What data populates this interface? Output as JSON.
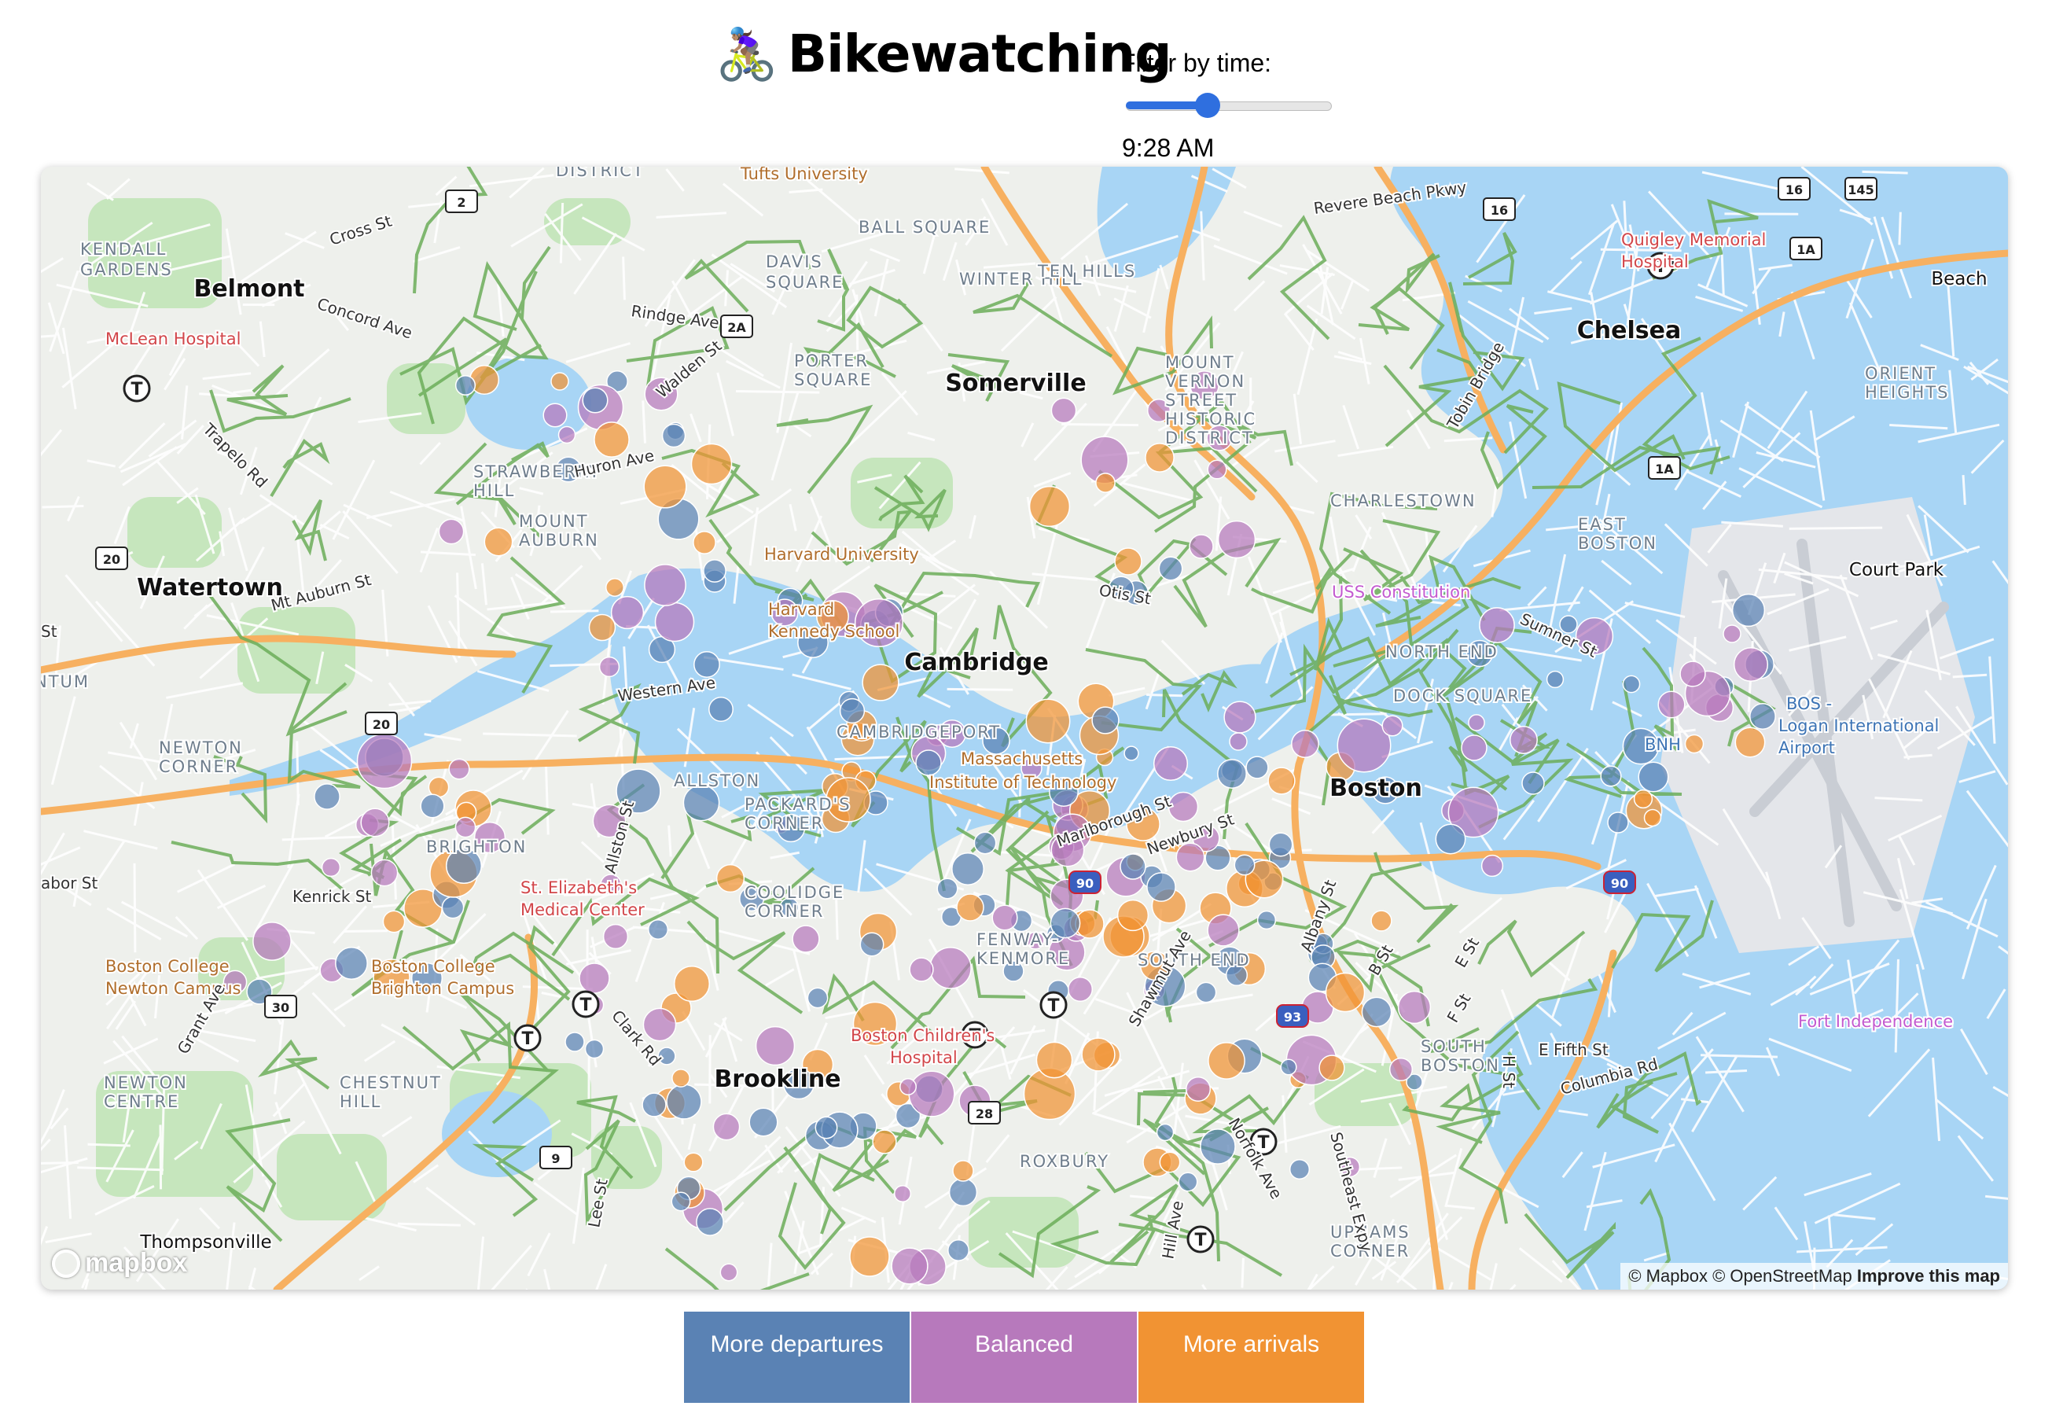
{
  "header": {
    "emoji": "🚴🏽‍♀️",
    "title": "Bikewatching",
    "filter_label": "Filter by time:",
    "slider_value_fraction": 0.4,
    "time_value": "9:28 AM"
  },
  "map": {
    "place_labels": [
      {
        "text": "Belmont",
        "size": "big"
      },
      {
        "text": "Somerville",
        "size": "big"
      },
      {
        "text": "Chelsea",
        "size": "big"
      },
      {
        "text": "Watertown",
        "size": "big"
      },
      {
        "text": "Cambridge",
        "size": "big"
      },
      {
        "text": "Boston",
        "size": "big"
      },
      {
        "text": "Brookline",
        "size": "big"
      },
      {
        "text": "Court Park",
        "size": "mid"
      },
      {
        "text": "Beach",
        "size": "mid"
      },
      {
        "text": "Thompsonville",
        "size": "mid"
      },
      {
        "text": "DISTRICT",
        "size": "hood"
      },
      {
        "text": "KENDALL",
        "size": "hood"
      },
      {
        "text": "GARDENS",
        "size": "hood"
      },
      {
        "text": "DAVIS",
        "size": "hood"
      },
      {
        "text": "SQUARE",
        "size": "hood"
      },
      {
        "text": "BALL SQUARE",
        "size": "hood"
      },
      {
        "text": "WINTER HILL",
        "size": "hood"
      },
      {
        "text": "TEN HILLS",
        "size": "hood"
      },
      {
        "text": "PORTER",
        "size": "hood"
      },
      {
        "text": "SQUARE",
        "size": "hood"
      },
      {
        "text": "MOUNT",
        "size": "hood"
      },
      {
        "text": "VERNON",
        "size": "hood"
      },
      {
        "text": "STREET",
        "size": "hood"
      },
      {
        "text": "HISTORIC",
        "size": "hood"
      },
      {
        "text": "DISTRICT",
        "size": "hood"
      },
      {
        "text": "STRAWBERRY",
        "size": "hood"
      },
      {
        "text": "HILL",
        "size": "hood"
      },
      {
        "text": "MOUNT",
        "size": "hood"
      },
      {
        "text": "AUBURN",
        "size": "hood"
      },
      {
        "text": "CHARLESTOWN",
        "size": "hood"
      },
      {
        "text": "EAST",
        "size": "hood"
      },
      {
        "text": "BOSTON",
        "size": "hood"
      },
      {
        "text": "ORIENT",
        "size": "hood"
      },
      {
        "text": "HEIGHTS",
        "size": "hood"
      },
      {
        "text": "NORTH END",
        "size": "hood"
      },
      {
        "text": "DOCK SQUARE",
        "size": "hood"
      },
      {
        "text": "NEWTON",
        "size": "hood"
      },
      {
        "text": "CORNER",
        "size": "hood"
      },
      {
        "text": "CAMBRIDGEPORT",
        "size": "hood"
      },
      {
        "text": "ALLSTON",
        "size": "hood"
      },
      {
        "text": "PACKARD'S",
        "size": "hood"
      },
      {
        "text": "CORNER",
        "size": "hood"
      },
      {
        "text": "BRIGHTON",
        "size": "hood"
      },
      {
        "text": "COOLIDGE",
        "size": "hood"
      },
      {
        "text": "CORNER",
        "size": "hood"
      },
      {
        "text": "FENWAY-",
        "size": "hood"
      },
      {
        "text": "KENMORE",
        "size": "hood"
      },
      {
        "text": "SOUTH END",
        "size": "hood"
      },
      {
        "text": "SOUTH",
        "size": "hood"
      },
      {
        "text": "BOSTON",
        "size": "hood"
      },
      {
        "text": "NEWTON",
        "size": "hood"
      },
      {
        "text": "CENTRE",
        "size": "hood"
      },
      {
        "text": "CHESTNUT",
        "size": "hood"
      },
      {
        "text": "HILL",
        "size": "hood"
      },
      {
        "text": "ROXBURY",
        "size": "hood"
      },
      {
        "text": "UPHAMS",
        "size": "hood"
      },
      {
        "text": "CORNER",
        "size": "hood"
      },
      {
        "text": "NTUM",
        "size": "hood"
      }
    ],
    "poi_labels": [
      {
        "text": "Tufts University",
        "kind": "edu"
      },
      {
        "text": "Quigley Memorial",
        "kind": "med"
      },
      {
        "text": "Hospital",
        "kind": "med"
      },
      {
        "text": "McLean Hospital",
        "kind": "med"
      },
      {
        "text": "Harvard University",
        "kind": "edu"
      },
      {
        "text": "Harvard",
        "kind": "edu"
      },
      {
        "text": "Kennedy School",
        "kind": "edu"
      },
      {
        "text": "USS Constitution",
        "kind": "hist"
      },
      {
        "text": "Massachusetts",
        "kind": "edu"
      },
      {
        "text": "Institute of Technology",
        "kind": "edu"
      },
      {
        "text": "St. Elizabeth's",
        "kind": "med"
      },
      {
        "text": "Medical Center",
        "kind": "med"
      },
      {
        "text": "Boston College",
        "kind": "edu"
      },
      {
        "text": "Newton Campus",
        "kind": "edu"
      },
      {
        "text": "Boston College",
        "kind": "edu"
      },
      {
        "text": "Brighton Campus",
        "kind": "edu"
      },
      {
        "text": "Boston Children's",
        "kind": "med"
      },
      {
        "text": "Hospital",
        "kind": "med"
      },
      {
        "text": "Fort Independence",
        "kind": "hist"
      },
      {
        "text": "BOS -",
        "kind": "air"
      },
      {
        "text": "Logan International",
        "kind": "air"
      },
      {
        "text": "Airport",
        "kind": "air"
      },
      {
        "text": "BNH",
        "kind": "air"
      }
    ],
    "street_labels": [
      "Cross St",
      "Concord Ave",
      "Rindge Ave",
      "Walden St",
      "Huron Ave",
      "Trapelo Rd",
      "Mt Auburn St",
      "Western Ave",
      "Otis St",
      "Revere Beach Pkwy",
      "Tobin Bridge",
      "Sumner St",
      "Kenrick St",
      "Allston St",
      "Clark Rd",
      "Grant Ave",
      "Marlborough St",
      "Newbury St",
      "Shawmut Ave",
      "Albany St",
      "B St",
      "E St",
      "F St",
      "H St",
      "E Fifth St",
      "Columbia Rd",
      "Norfolk Ave",
      "Southeast Expy",
      "Lee St",
      "Hill Ave",
      "St",
      "abor St"
    ],
    "shields": [
      "2",
      "2A",
      "16",
      "16",
      "145",
      "1A",
      "1A",
      "20",
      "20",
      "30",
      "9",
      "28",
      "90",
      "90",
      "93"
    ],
    "attribution": {
      "mapbox": "© Mapbox",
      "osm": "© OpenStreetMap",
      "improve": "Improve this map"
    },
    "logo_text": "mapbox"
  },
  "colors": {
    "departures": "#5a82b4",
    "balanced": "#b779bc",
    "arrivals": "#f19333",
    "water": "#a8d5f5",
    "park": "#c6e6bd",
    "bike_lane": "#6cae5a",
    "highway": "#f7b060"
  },
  "legend": [
    {
      "label": "More departures",
      "color": "#5a82b4"
    },
    {
      "label": "Balanced",
      "color": "#b779bc"
    },
    {
      "label": "More arrivals",
      "color": "#f19333"
    }
  ],
  "stations": [
    {
      "t": "d",
      "v": 3
    },
    {
      "t": "d",
      "v": 2
    },
    {
      "t": "b",
      "v": 2
    },
    {
      "t": "d",
      "v": 4
    },
    {
      "t": "b",
      "v": 4
    },
    {
      "t": "o",
      "v": 3
    },
    {
      "t": "d",
      "v": 5
    },
    {
      "t": "b",
      "v": 6
    },
    {
      "t": "d",
      "v": 3
    },
    {
      "t": "b",
      "v": 3
    },
    {
      "t": "d",
      "v": 5
    },
    {
      "t": "o",
      "v": 6
    },
    {
      "t": "d",
      "v": 4
    },
    {
      "t": "b",
      "v": 6
    },
    {
      "t": "o",
      "v": 7
    },
    {
      "t": "d",
      "v": 6
    },
    {
      "t": "b",
      "v": 8
    },
    {
      "t": "o",
      "v": 8
    },
    {
      "t": "d",
      "v": 7
    },
    {
      "t": "b",
      "v": 9
    },
    {
      "t": "o",
      "v": 9
    },
    {
      "t": "d",
      "v": 8
    },
    {
      "t": "b",
      "v": 10
    },
    {
      "t": "o",
      "v": 10
    },
    {
      "t": "d",
      "v": 6
    },
    {
      "t": "b",
      "v": 7
    },
    {
      "t": "o",
      "v": 5
    },
    {
      "t": "d",
      "v": 4
    },
    {
      "t": "b",
      "v": 5
    },
    {
      "t": "o",
      "v": 4
    },
    {
      "t": "d",
      "v": 5
    },
    {
      "t": "b",
      "v": 6
    },
    {
      "t": "o",
      "v": 7
    },
    {
      "t": "d",
      "v": 3
    },
    {
      "t": "b",
      "v": 4
    },
    {
      "t": "o",
      "v": 3
    }
  ]
}
